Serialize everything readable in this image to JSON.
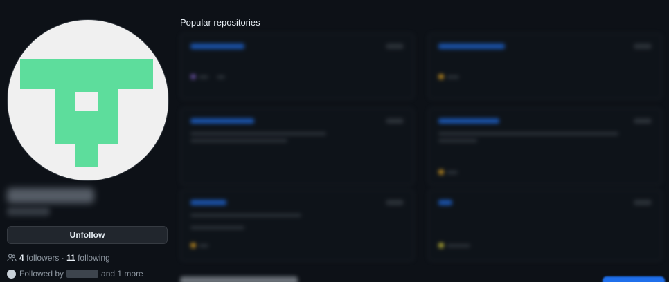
{
  "sidebar": {
    "avatar": {
      "icon": "identicon-avatar",
      "colors": {
        "background": "#f0f0f0",
        "glyph": "#5ddd9c"
      }
    },
    "unfollow_label": "Unfollow",
    "followers": {
      "icon": "people-icon",
      "followers_count": "4",
      "followers_label": " followers",
      "separator": " · ",
      "following_count": "11",
      "following_label": " following"
    },
    "followed_by": {
      "prefix": "Followed by",
      "suffix": "and 1 more"
    }
  },
  "main": {
    "popular_title": "Popular repositories"
  },
  "colors": {
    "page_bg": "#0d1117",
    "button_bg": "#21262d",
    "muted_text": "#8d96a0",
    "primary_text": "#e6edf3",
    "accent_blue": "#1f6feb"
  }
}
